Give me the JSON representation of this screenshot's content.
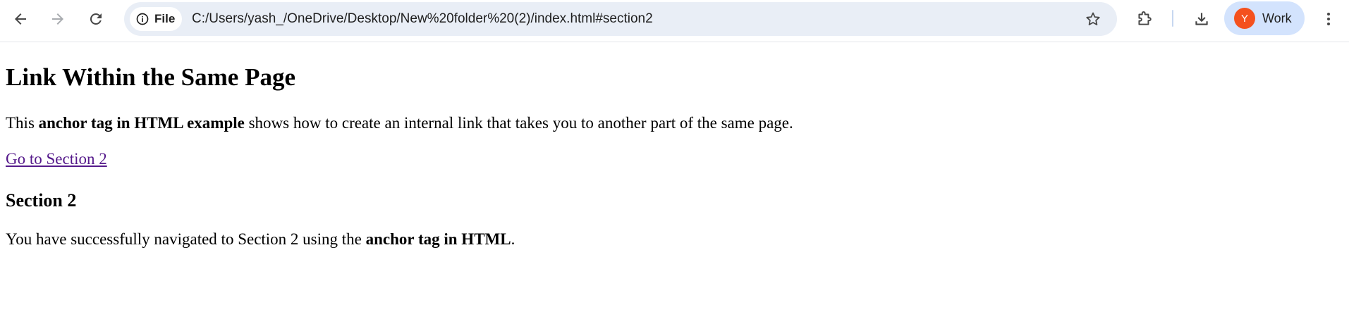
{
  "browser": {
    "site_chip_label": "File",
    "url": "C:/Users/yash_/OneDrive/Desktop/New%20folder%20(2)/index.html#section2",
    "profile": {
      "initial": "Y",
      "label": "Work",
      "avatar_color": "#f4511e",
      "chip_color": "#d3e3fd"
    },
    "omnibox_color": "#e9eef6",
    "icons": [
      "back-arrow-icon",
      "forward-arrow-icon",
      "reload-icon",
      "info-icon",
      "star-icon",
      "extensions-icon",
      "download-icon",
      "more-vert-icon"
    ]
  },
  "page": {
    "heading": "Link Within the Same Page",
    "intro": {
      "prefix": "This ",
      "bold": "anchor tag in HTML example",
      "suffix": " shows how to create an internal link that takes you to another part of the same page."
    },
    "link_text": "Go to Section 2",
    "link_color": "#551a8b",
    "section_heading": "Section 2",
    "section_text": {
      "prefix": "You have successfully navigated to Section 2 using the ",
      "bold": "anchor tag in HTML",
      "suffix": "."
    }
  }
}
